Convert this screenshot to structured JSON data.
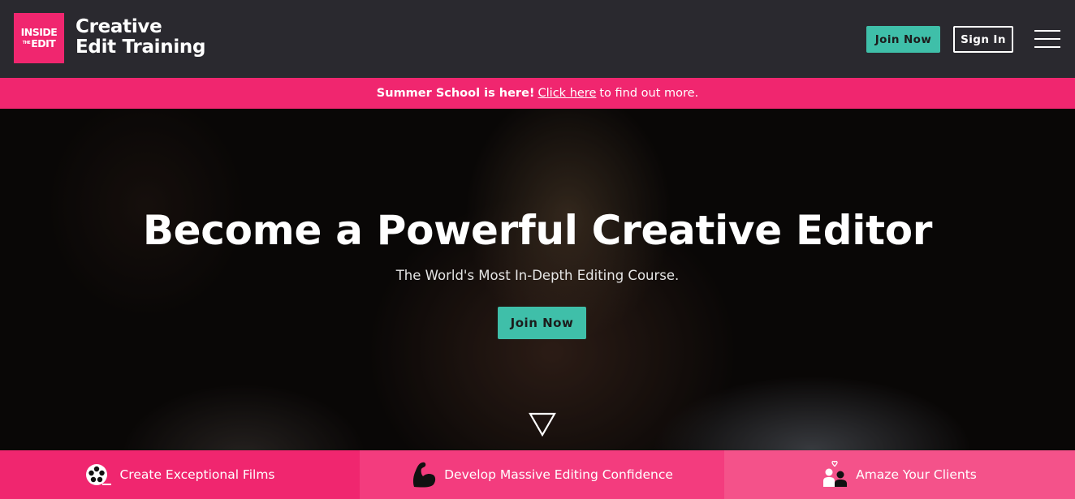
{
  "header": {
    "logo": {
      "line1": "INSIDE",
      "line2_small": "THE",
      "line2": "EDIT"
    },
    "brand_line1": "Creative",
    "brand_line2": "Edit Training",
    "join_label": "Join Now",
    "signin_label": "Sign In",
    "menu_icon": "hamburger-icon"
  },
  "promo": {
    "bold": "Summer School is here!",
    "link": "Click here",
    "rest": "to find out more."
  },
  "hero": {
    "title": "Become a Powerful Creative Editor",
    "subtitle": "The World's Most In-Depth Editing Course.",
    "cta_label": "Join Now",
    "scroll_icon": "triangle-down-icon"
  },
  "features": [
    {
      "label": "Create Exceptional Films",
      "icon": "film-reel-icon"
    },
    {
      "label": "Develop Massive Editing Confidence",
      "icon": "flexed-arm-icon"
    },
    {
      "label": "Amaze Your Clients",
      "icon": "people-heart-icon"
    }
  ],
  "colors": {
    "header_bg": "#2a292f",
    "brand_pink": "#f0266f",
    "teal": "#3fbfa9"
  }
}
